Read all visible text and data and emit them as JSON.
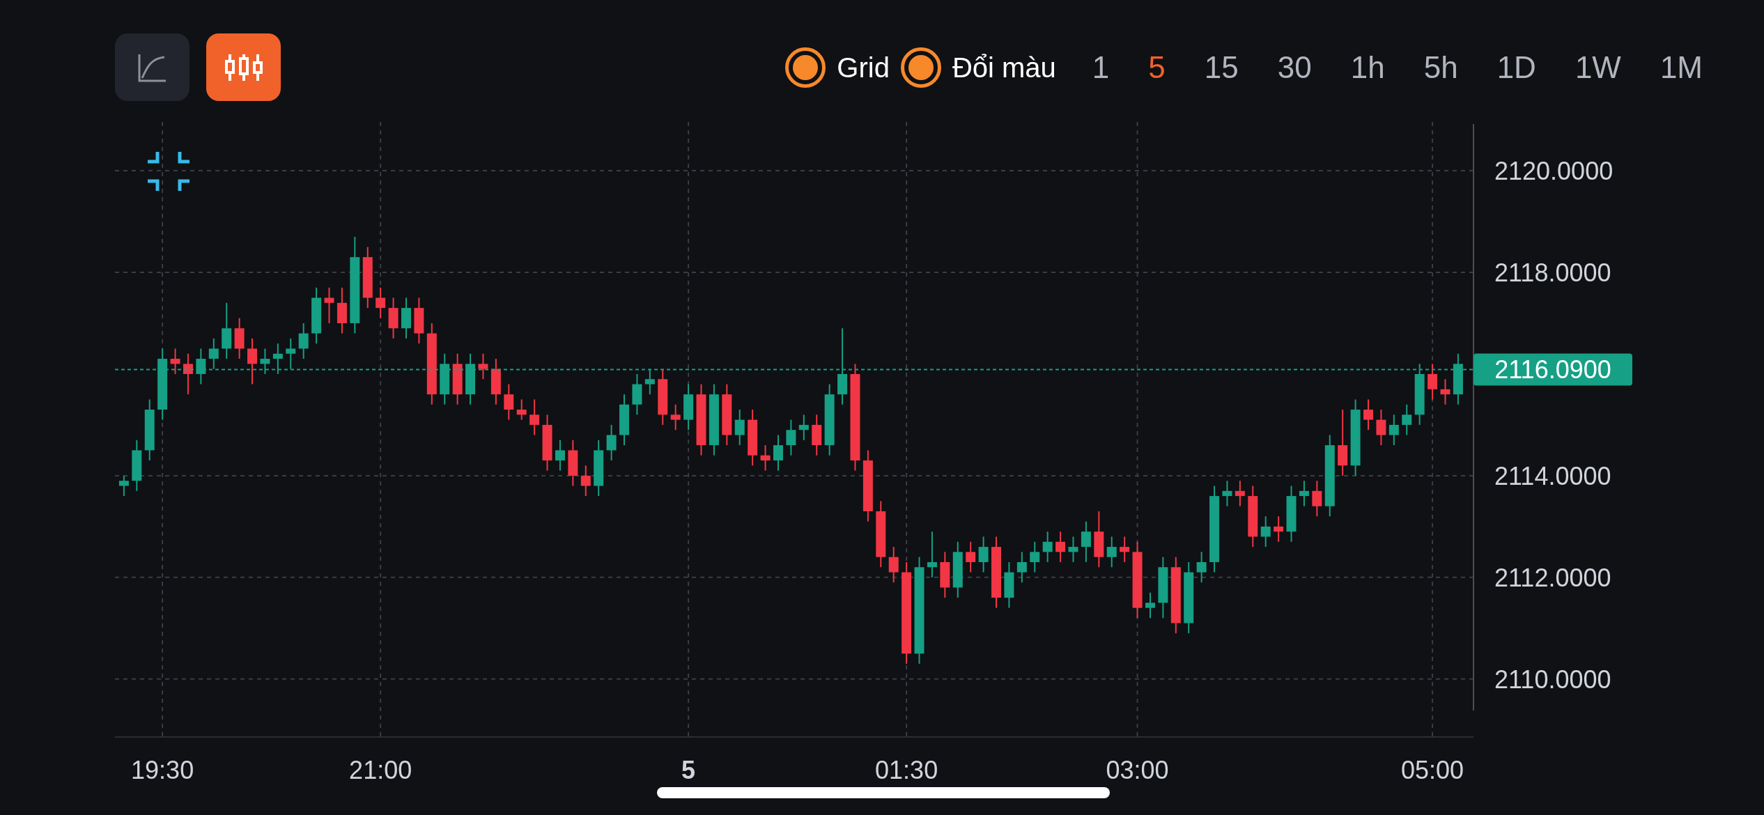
{
  "toolbar": {
    "chart_types": [
      {
        "kind": "line",
        "selected": false
      },
      {
        "kind": "candle",
        "selected": true
      }
    ],
    "options": [
      {
        "label": "Grid",
        "checked": true
      },
      {
        "label": "Đổi màu",
        "checked": true
      }
    ],
    "intervals": [
      {
        "label": "1",
        "selected": false
      },
      {
        "label": "5",
        "selected": true
      },
      {
        "label": "15",
        "selected": false
      },
      {
        "label": "30",
        "selected": false
      },
      {
        "label": "1h",
        "selected": false
      },
      {
        "label": "5h",
        "selected": false
      },
      {
        "label": "1D",
        "selected": false
      },
      {
        "label": "1W",
        "selected": false
      },
      {
        "label": "1M",
        "selected": false
      }
    ]
  },
  "chart": {
    "x_labels": [
      {
        "bold": false
      },
      {
        "bold": false
      },
      {
        "bold": true
      },
      {
        "bold": false
      },
      {
        "bold": false
      },
      {
        "bold": false
      }
    ],
    "chart_data": {
      "type": "candlestick",
      "grid": true,
      "ref_lines": [
        {
          "axis": "y",
          "value": 2116.09,
          "label": "2116.0900",
          "color": "#16a085"
        }
      ],
      "ylim": [
        2108.86,
        2120.96
      ],
      "categories": [
        null,
        null,
        null,
        "19:30",
        null,
        null,
        null,
        null,
        null,
        null,
        null,
        null,
        null,
        null,
        null,
        null,
        null,
        null,
        null,
        null,
        "21:00",
        null,
        null,
        null,
        null,
        null,
        null,
        null,
        null,
        null,
        null,
        null,
        null,
        null,
        null,
        null,
        null,
        null,
        null,
        null,
        null,
        null,
        null,
        null,
        "5",
        null,
        null,
        null,
        null,
        null,
        null,
        null,
        null,
        null,
        null,
        null,
        null,
        null,
        null,
        null,
        null,
        "01:30",
        null,
        null,
        null,
        null,
        null,
        null,
        null,
        null,
        null,
        null,
        null,
        null,
        null,
        null,
        null,
        null,
        null,
        "03:00",
        null,
        null,
        null,
        null,
        null,
        null,
        null,
        null,
        null,
        null,
        null,
        null,
        null,
        null,
        null,
        null,
        null,
        null,
        null,
        null,
        null,
        null,
        "05:00",
        null,
        null
      ],
      "yticks": [
        {
          "value": 2120,
          "label": "2120.0000"
        },
        {
          "value": 2118,
          "label": "2118.0000"
        },
        {
          "value": 2114,
          "label": "2114.0000"
        },
        {
          "value": 2112,
          "label": "2112.0000"
        },
        {
          "value": 2110,
          "label": "2110.0000"
        }
      ],
      "ohlc": [
        [
          2113.8,
          2114.0,
          2113.6,
          2113.9
        ],
        [
          2113.9,
          2114.7,
          2113.7,
          2114.5
        ],
        [
          2114.5,
          2115.5,
          2114.3,
          2115.3
        ],
        [
          2115.3,
          2116.5,
          2115.1,
          2116.3
        ],
        [
          2116.3,
          2116.5,
          2116.0,
          2116.2
        ],
        [
          2116.2,
          2116.4,
          2115.6,
          2116.0
        ],
        [
          2116.0,
          2116.5,
          2115.8,
          2116.3
        ],
        [
          2116.3,
          2116.7,
          2116.1,
          2116.5
        ],
        [
          2116.5,
          2117.4,
          2116.3,
          2116.9
        ],
        [
          2116.9,
          2117.1,
          2116.3,
          2116.5
        ],
        [
          2116.5,
          2116.7,
          2115.8,
          2116.2
        ],
        [
          2116.2,
          2116.5,
          2116.0,
          2116.3
        ],
        [
          2116.3,
          2116.6,
          2116.0,
          2116.4
        ],
        [
          2116.4,
          2116.7,
          2116.1,
          2116.5
        ],
        [
          2116.5,
          2117.0,
          2116.3,
          2116.8
        ],
        [
          2116.8,
          2117.7,
          2116.6,
          2117.5
        ],
        [
          2117.5,
          2117.7,
          2117.0,
          2117.4
        ],
        [
          2117.4,
          2117.7,
          2116.8,
          2117.0
        ],
        [
          2117.0,
          2118.7,
          2116.8,
          2118.3
        ],
        [
          2118.3,
          2118.5,
          2117.3,
          2117.5
        ],
        [
          2117.5,
          2117.7,
          2117.1,
          2117.3
        ],
        [
          2117.3,
          2117.5,
          2116.7,
          2116.9
        ],
        [
          2116.9,
          2117.5,
          2116.7,
          2117.3
        ],
        [
          2117.3,
          2117.5,
          2116.6,
          2116.8
        ],
        [
          2116.8,
          2117.0,
          2115.4,
          2115.6
        ],
        [
          2115.6,
          2116.4,
          2115.4,
          2116.2
        ],
        [
          2116.2,
          2116.4,
          2115.4,
          2115.6
        ],
        [
          2115.6,
          2116.4,
          2115.4,
          2116.2
        ],
        [
          2116.2,
          2116.4,
          2115.9,
          2116.1
        ],
        [
          2116.1,
          2116.3,
          2115.4,
          2115.6
        ],
        [
          2115.6,
          2115.8,
          2115.1,
          2115.3
        ],
        [
          2115.3,
          2115.5,
          2115.1,
          2115.2
        ],
        [
          2115.2,
          2115.5,
          2114.8,
          2115.0
        ],
        [
          2115.0,
          2115.2,
          2114.1,
          2114.3
        ],
        [
          2114.3,
          2114.7,
          2114.1,
          2114.5
        ],
        [
          2114.5,
          2114.7,
          2113.8,
          2114.0
        ],
        [
          2114.0,
          2114.2,
          2113.6,
          2113.8
        ],
        [
          2113.8,
          2114.7,
          2113.6,
          2114.5
        ],
        [
          2114.5,
          2115.0,
          2114.3,
          2114.8
        ],
        [
          2114.8,
          2115.6,
          2114.6,
          2115.4
        ],
        [
          2115.4,
          2116.0,
          2115.2,
          2115.8
        ],
        [
          2115.8,
          2116.1,
          2115.6,
          2115.9
        ],
        [
          2115.9,
          2116.1,
          2115.0,
          2115.2
        ],
        [
          2115.2,
          2115.4,
          2114.9,
          2115.1
        ],
        [
          2115.1,
          2115.8,
          2114.9,
          2115.6
        ],
        [
          2115.6,
          2115.8,
          2114.4,
          2114.6
        ],
        [
          2114.6,
          2115.8,
          2114.4,
          2115.6
        ],
        [
          2115.6,
          2115.8,
          2114.6,
          2114.8
        ],
        [
          2114.8,
          2115.3,
          2114.6,
          2115.1
        ],
        [
          2115.1,
          2115.3,
          2114.2,
          2114.4
        ],
        [
          2114.4,
          2114.6,
          2114.1,
          2114.3
        ],
        [
          2114.3,
          2114.8,
          2114.1,
          2114.6
        ],
        [
          2114.6,
          2115.1,
          2114.4,
          2114.9
        ],
        [
          2114.9,
          2115.2,
          2114.7,
          2115.0
        ],
        [
          2115.0,
          2115.2,
          2114.4,
          2114.6
        ],
        [
          2114.6,
          2115.8,
          2114.4,
          2115.6
        ],
        [
          2115.6,
          2116.9,
          2115.4,
          2116.0
        ],
        [
          2116.0,
          2116.2,
          2114.1,
          2114.3
        ],
        [
          2114.3,
          2114.5,
          2113.1,
          2113.3
        ],
        [
          2113.3,
          2113.5,
          2112.2,
          2112.4
        ],
        [
          2112.4,
          2112.6,
          2111.9,
          2112.1
        ],
        [
          2112.1,
          2112.3,
          2110.3,
          2110.5
        ],
        [
          2110.5,
          2112.4,
          2110.3,
          2112.2
        ],
        [
          2112.2,
          2112.9,
          2112.0,
          2112.3
        ],
        [
          2112.3,
          2112.5,
          2111.6,
          2111.8
        ],
        [
          2111.8,
          2112.7,
          2111.6,
          2112.5
        ],
        [
          2112.5,
          2112.7,
          2112.1,
          2112.3
        ],
        [
          2112.3,
          2112.8,
          2112.1,
          2112.6
        ],
        [
          2112.6,
          2112.8,
          2111.4,
          2111.6
        ],
        [
          2111.6,
          2112.3,
          2111.4,
          2112.1
        ],
        [
          2112.1,
          2112.5,
          2111.9,
          2112.3
        ],
        [
          2112.3,
          2112.7,
          2112.1,
          2112.5
        ],
        [
          2112.5,
          2112.9,
          2112.3,
          2112.7
        ],
        [
          2112.7,
          2112.9,
          2112.3,
          2112.5
        ],
        [
          2112.5,
          2112.8,
          2112.3,
          2112.6
        ],
        [
          2112.6,
          2113.1,
          2112.3,
          2112.9
        ],
        [
          2112.9,
          2113.3,
          2112.2,
          2112.4
        ],
        [
          2112.4,
          2112.8,
          2112.2,
          2112.6
        ],
        [
          2112.6,
          2112.8,
          2112.3,
          2112.5
        ],
        [
          2112.5,
          2112.7,
          2111.2,
          2111.4
        ],
        [
          2111.4,
          2111.7,
          2111.2,
          2111.5
        ],
        [
          2111.5,
          2112.4,
          2111.2,
          2112.2
        ],
        [
          2112.2,
          2112.4,
          2110.9,
          2111.1
        ],
        [
          2111.1,
          2112.3,
          2110.9,
          2112.1
        ],
        [
          2112.1,
          2112.5,
          2111.9,
          2112.3
        ],
        [
          2112.3,
          2113.8,
          2112.1,
          2113.6
        ],
        [
          2113.6,
          2113.9,
          2113.4,
          2113.7
        ],
        [
          2113.7,
          2113.9,
          2113.4,
          2113.6
        ],
        [
          2113.6,
          2113.8,
          2112.6,
          2112.8
        ],
        [
          2112.8,
          2113.2,
          2112.6,
          2113.0
        ],
        [
          2113.0,
          2113.2,
          2112.7,
          2112.9
        ],
        [
          2112.9,
          2113.8,
          2112.7,
          2113.6
        ],
        [
          2113.6,
          2113.9,
          2113.4,
          2113.7
        ],
        [
          2113.7,
          2113.9,
          2113.2,
          2113.4
        ],
        [
          2113.4,
          2114.8,
          2113.2,
          2114.6
        ],
        [
          2114.6,
          2115.3,
          2114.0,
          2114.2
        ],
        [
          2114.2,
          2115.5,
          2114.0,
          2115.3
        ],
        [
          2115.3,
          2115.5,
          2114.9,
          2115.1
        ],
        [
          2115.1,
          2115.3,
          2114.6,
          2114.8
        ],
        [
          2114.8,
          2115.2,
          2114.6,
          2115.0
        ],
        [
          2115.0,
          2115.4,
          2114.8,
          2115.2
        ],
        [
          2115.2,
          2116.2,
          2115.0,
          2116.0
        ],
        [
          2116.0,
          2116.2,
          2115.5,
          2115.7
        ],
        [
          2115.7,
          2115.9,
          2115.4,
          2115.6
        ],
        [
          2115.6,
          2116.4,
          2115.4,
          2116.2
        ]
      ]
    }
  }
}
